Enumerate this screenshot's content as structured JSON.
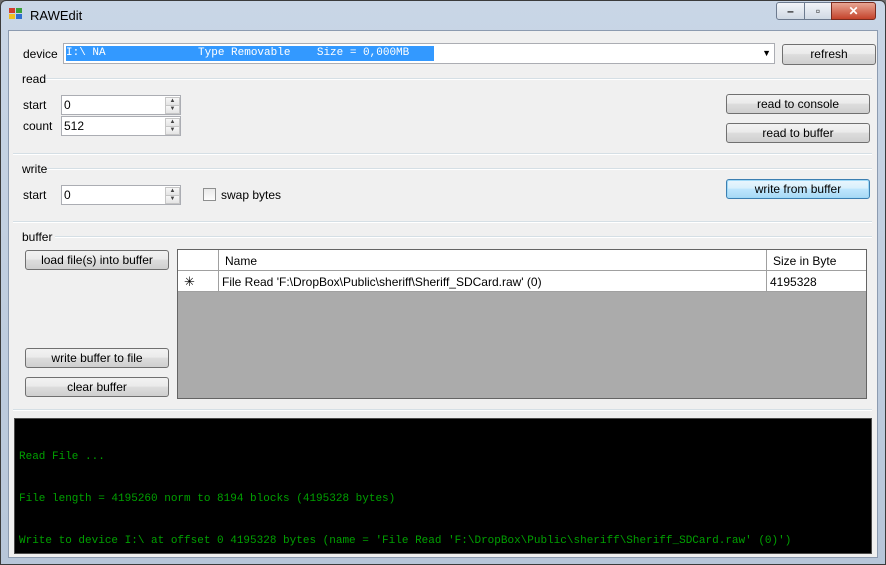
{
  "window": {
    "title": "RAWEdit"
  },
  "device": {
    "label": "device",
    "selected": "I:\\ NA              Type Removable    Size = 0,000MB",
    "refresh_label": "refresh"
  },
  "read": {
    "group_label": "read",
    "start_label": "start",
    "start_value": "0",
    "count_label": "count",
    "count_value": "512",
    "to_console_label": "read to console",
    "to_buffer_label": "read to buffer"
  },
  "write": {
    "group_label": "write",
    "start_label": "start",
    "start_value": "0",
    "swap_label": "swap bytes",
    "from_buffer_label": "write from buffer"
  },
  "buffer": {
    "group_label": "buffer",
    "load_label": "load file(s) into buffer",
    "write_to_file_label": "write buffer to file",
    "clear_label": "clear buffer",
    "columns": [
      "Name",
      "Size in Byte"
    ],
    "rows": [
      {
        "marker": "✳",
        "name": "File Read 'F:\\DropBox\\Public\\sheriff\\Sheriff_SDCard.raw' (0)",
        "size": "4195328"
      }
    ]
  },
  "console": {
    "lines": [
      "Read File ...",
      "File length = 4195260 norm to 8194 blocks (4195328 bytes)",
      "Write to device I:\\ at offset 0 4195328 bytes (name = 'File Read 'F:\\DropBox\\Public\\sheriff\\Sheriff_SDCard.raw' (0)')"
    ]
  },
  "colors": {
    "selection": "#3399ff",
    "console_text": "#00a000",
    "console_bg": "#000000"
  }
}
